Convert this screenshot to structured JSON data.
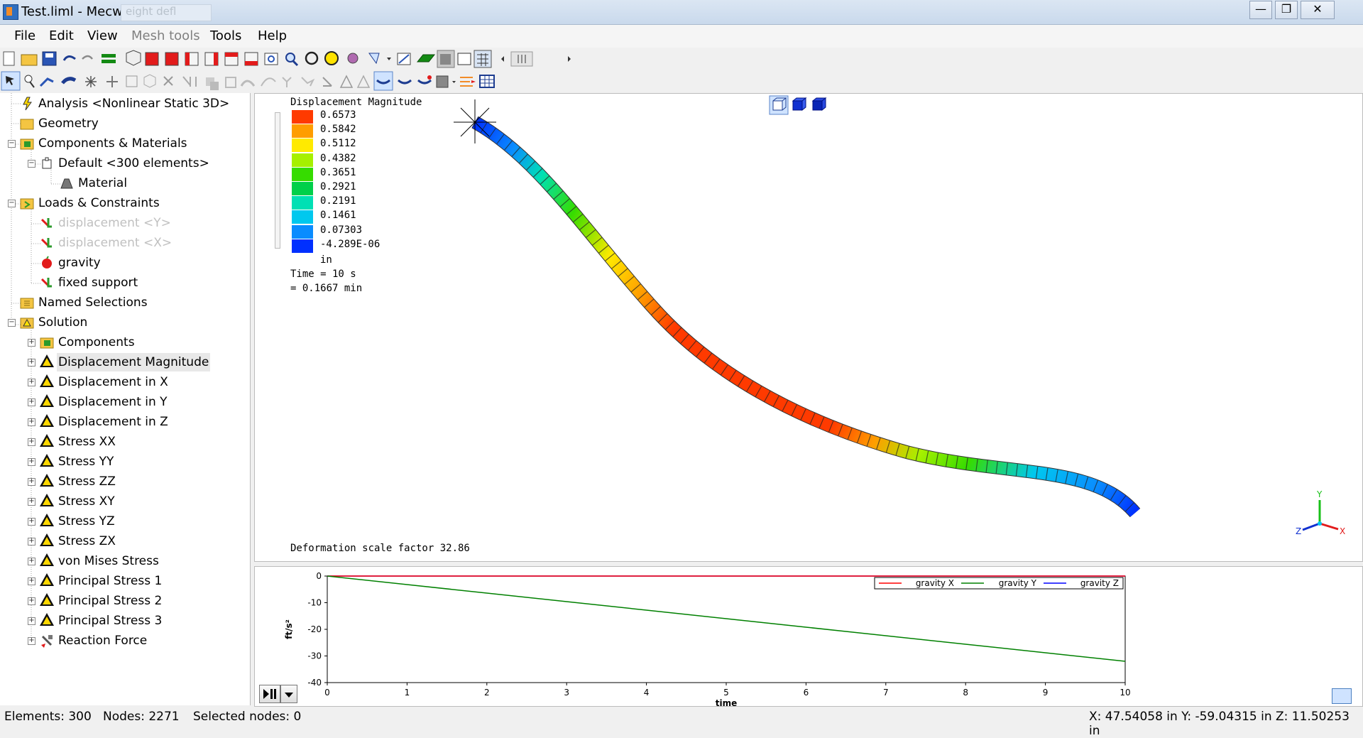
{
  "window": {
    "title": "Test.liml - Mecway",
    "ghost_tab": "eight defl",
    "minimize": "—",
    "maximize": "❐",
    "close": "✕"
  },
  "menu": [
    "File",
    "Edit",
    "View",
    "Mesh tools",
    "Tools",
    "Help"
  ],
  "tree": {
    "analysis": "Analysis <Nonlinear Static 3D>",
    "geometry": "Geometry",
    "components_materials": "Components & Materials",
    "default_component": "Default <300 elements>",
    "material": "Material",
    "loads_constraints": "Loads & Constraints",
    "displacement_y": "displacement <Y>",
    "displacement_x": "displacement <X>",
    "gravity": "gravity",
    "fixed_support": "fixed support",
    "named_selections": "Named Selections",
    "solution": "Solution",
    "solution_items": [
      "Components",
      "Displacement Magnitude",
      "Displacement in X",
      "Displacement in Y",
      "Displacement in Z",
      "Stress XX",
      "Stress YY",
      "Stress ZZ",
      "Stress XY",
      "Stress YZ",
      "Stress ZX",
      "von Mises Stress",
      "Principal Stress 1",
      "Principal Stress 2",
      "Principal Stress 3",
      "Reaction Force"
    ]
  },
  "legend": {
    "title": "Displacement Magnitude",
    "values": [
      "0.6573",
      "0.5842",
      "0.5112",
      "0.4382",
      "0.3651",
      "0.2921",
      "0.2191",
      "0.1461",
      "0.07303",
      "-4.289E-06"
    ],
    "colors": [
      "#ff3a00",
      "#ff9d00",
      "#ffea00",
      "#a6f000",
      "#36dc00",
      "#00d04a",
      "#00e0b4",
      "#00c8ee",
      "#0a8cff",
      "#0030ff"
    ],
    "unit": "in",
    "time_line1": "Time = 10 s",
    "time_line2": "= 0.1667 min"
  },
  "viewport": {
    "deformation_scale": "Deformation scale factor 32.86",
    "axis_labels": {
      "y": "Y",
      "x": "X",
      "z": "Z"
    }
  },
  "chart_data": {
    "type": "line",
    "x": [
      0,
      1,
      2,
      3,
      4,
      5,
      6,
      7,
      8,
      9,
      10
    ],
    "xlabel": "time",
    "ylabel": "ft/s²",
    "xlim": [
      0,
      10
    ],
    "ylim": [
      -40,
      0
    ],
    "x_ticks": [
      "0",
      "1",
      "2",
      "3",
      "4",
      "5",
      "6",
      "7",
      "8",
      "9",
      "10"
    ],
    "y_ticks": [
      "0",
      "-10",
      "-20",
      "-30",
      "-40"
    ],
    "series": [
      {
        "name": "gravity X",
        "color": "#ff0000",
        "values": [
          0,
          0,
          0,
          0,
          0,
          0,
          0,
          0,
          0,
          0,
          0
        ]
      },
      {
        "name": "gravity Y",
        "color": "#008000",
        "values": [
          0,
          -3.2,
          -6.4,
          -9.6,
          -12.8,
          -16.0,
          -19.2,
          -22.4,
          -25.6,
          -28.8,
          -32.0
        ]
      },
      {
        "name": "gravity Z",
        "color": "#0000ff",
        "values": [
          0,
          0,
          0,
          0,
          0,
          0,
          0,
          0,
          0,
          0,
          0
        ]
      }
    ],
    "legend_position": "top-right"
  },
  "status": {
    "elements": "Elements: 300",
    "nodes": "Nodes: 2271",
    "selected": "Selected nodes: 0",
    "coords": "X: 47.54058 in Y: -59.04315 in Z: 11.50253 in"
  }
}
